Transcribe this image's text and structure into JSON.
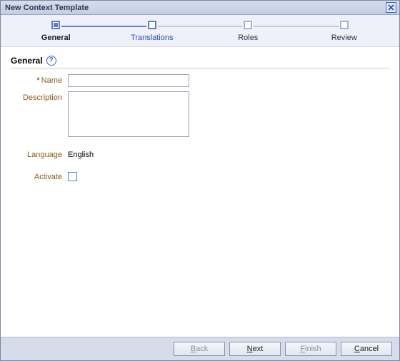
{
  "dialog": {
    "title": "New Context Template"
  },
  "steps": {
    "items": [
      {
        "label": "General"
      },
      {
        "label": "Translations"
      },
      {
        "label": "Roles"
      },
      {
        "label": "Review"
      }
    ],
    "current_index": 0
  },
  "section": {
    "title": "General"
  },
  "form": {
    "name_label": "Name",
    "name_value": "",
    "description_label": "Description",
    "description_value": "",
    "language_label": "Language",
    "language_value": "English",
    "activate_label": "Activate",
    "activate_checked": false
  },
  "buttons": {
    "back": "Back",
    "next": "Next",
    "finish": "Finish",
    "cancel": "Cancel"
  },
  "icons": {
    "help_glyph": "?"
  }
}
